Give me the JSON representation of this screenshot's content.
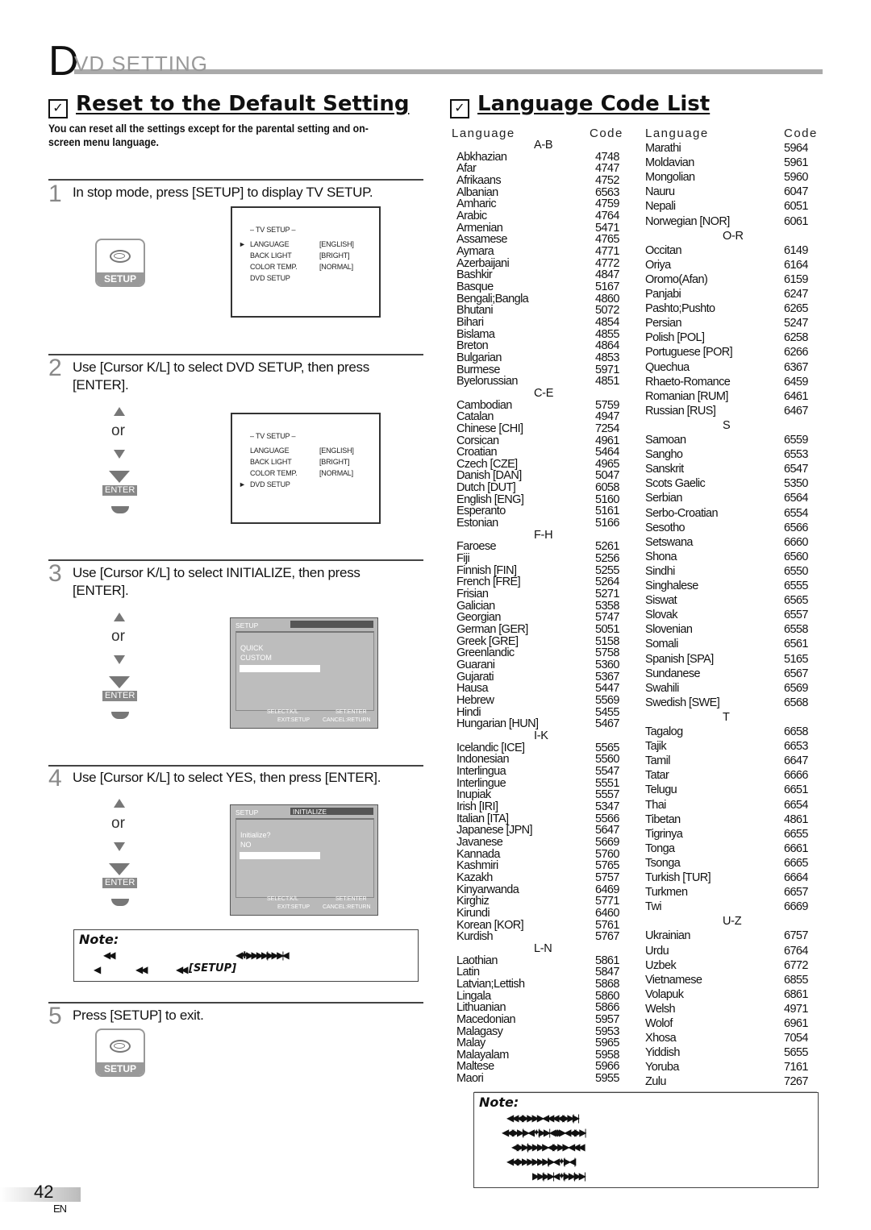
{
  "header": {
    "big_letter": "D",
    "rest": "VD  SETTING"
  },
  "reset_section": {
    "title": "Reset to the Default Setting",
    "intro": "You can reset all the settings except for the parental setting and on-screen menu language.",
    "steps": [
      {
        "num": "1",
        "text": "In stop mode, press [SETUP] to display  TV SETUP."
      },
      {
        "num": "2",
        "text": "Use [Cursor K/L] to select  DVD SETUP, then press [ENTER]."
      },
      {
        "num": "3",
        "text": "Use [Cursor K/L] to select  INITIALIZE, then press [ENTER]."
      },
      {
        "num": "4",
        "text": "Use [Cursor K/L] to select  YES, then press [ENTER]."
      },
      {
        "num": "5",
        "text": "Press [SETUP] to exit."
      }
    ],
    "setup_key_label": "SETUP",
    "enter_key_label": "ENTER",
    "or_label": "or",
    "tv_setup_screen": {
      "title": "– TV SETUP –",
      "items": [
        {
          "label": "LANGUAGE",
          "value": "[ENGLISH]"
        },
        {
          "label": "BACK LIGHT",
          "value": "[BRIGHT]"
        },
        {
          "label": "COLOR TEMP.",
          "value": "[NORMAL]"
        },
        {
          "label": "DVD SETUP",
          "value": ""
        }
      ],
      "cursor_marker": "►"
    },
    "osd_step3": {
      "title": "SETUP",
      "tab": "",
      "lines": [
        "QUICK",
        "CUSTOM"
      ],
      "footer": {
        "select": "SELECT:K/L",
        "set": "SET:ENTER",
        "exit": "EXIT:SETUP",
        "cancel": "CANCEL:RETURN"
      }
    },
    "osd_step4": {
      "title": "SETUP",
      "tab": "INITIALIZE",
      "lines": [
        "Initialize?",
        "NO"
      ],
      "footer": {
        "select": "SELECT:K/L",
        "set": "SET:ENTER",
        "exit": "EXIT:SETUP",
        "cancel": "CANCEL:RETURN"
      }
    },
    "note": {
      "title": "Note:",
      "line1a": "◀◀",
      "line1b": "◀✱▶▶▶▶|▶▶ ▶|◀",
      "line2a": "◀",
      "line2b": "◀◀",
      "line2c": "◀◀",
      "line2d": "[SETUP]"
    }
  },
  "language_section": {
    "title": "Language Code List",
    "col_language": "Language",
    "col_code": "Code",
    "left_column": [
      {
        "group": "A-B"
      },
      {
        "name": "Abkhazian",
        "code": "4748"
      },
      {
        "name": "Afar",
        "code": "4747"
      },
      {
        "name": "Afrikaans",
        "code": "4752"
      },
      {
        "name": "Albanian",
        "code": "6563"
      },
      {
        "name": "Amharic",
        "code": "4759"
      },
      {
        "name": "Arabic",
        "code": "4764"
      },
      {
        "name": "Armenian",
        "code": "5471"
      },
      {
        "name": "Assamese",
        "code": "4765"
      },
      {
        "name": "Aymara",
        "code": "4771"
      },
      {
        "name": "Azerbaijani",
        "code": "4772"
      },
      {
        "name": "Bashkir",
        "code": "4847"
      },
      {
        "name": "Basque",
        "code": "5167"
      },
      {
        "name": "Bengali;Bangla",
        "code": "4860"
      },
      {
        "name": "Bhutani",
        "code": "5072"
      },
      {
        "name": "Bihari",
        "code": "4854"
      },
      {
        "name": "Bislama",
        "code": "4855"
      },
      {
        "name": "Breton",
        "code": "4864"
      },
      {
        "name": "Bulgarian",
        "code": "4853"
      },
      {
        "name": "Burmese",
        "code": "5971"
      },
      {
        "name": "Byelorussian",
        "code": "4851"
      },
      {
        "group": "C-E"
      },
      {
        "name": "Cambodian",
        "code": "5759"
      },
      {
        "name": "Catalan",
        "code": "4947"
      },
      {
        "name": "Chinese [CHI]",
        "code": "7254"
      },
      {
        "name": "Corsican",
        "code": "4961"
      },
      {
        "name": "Croatian",
        "code": "5464"
      },
      {
        "name": "Czech [CZE]",
        "code": "4965"
      },
      {
        "name": "Danish [DAN]",
        "code": "5047"
      },
      {
        "name": "Dutch [DUT]",
        "code": "6058"
      },
      {
        "name": "English [ENG]",
        "code": "5160"
      },
      {
        "name": "Esperanto",
        "code": "5161"
      },
      {
        "name": "Estonian",
        "code": "5166"
      },
      {
        "group": "F-H"
      },
      {
        "name": "Faroese",
        "code": "5261"
      },
      {
        "name": "Fiji",
        "code": "5256"
      },
      {
        "name": "Finnish [FIN]",
        "code": "5255"
      },
      {
        "name": "French [FRE]",
        "code": "5264"
      },
      {
        "name": "Frisian",
        "code": "5271"
      },
      {
        "name": "Galician",
        "code": "5358"
      },
      {
        "name": "Georgian",
        "code": "5747"
      },
      {
        "name": "German [GER]",
        "code": "5051"
      },
      {
        "name": "Greek [GRE]",
        "code": "5158"
      },
      {
        "name": "Greenlandic",
        "code": "5758"
      },
      {
        "name": "Guarani",
        "code": "5360"
      },
      {
        "name": "Gujarati",
        "code": "5367"
      },
      {
        "name": "Hausa",
        "code": "5447"
      },
      {
        "name": "Hebrew",
        "code": "5569"
      },
      {
        "name": "Hindi",
        "code": "5455"
      },
      {
        "name": "Hungarian [HUN]",
        "code": "5467"
      },
      {
        "group": "I-K"
      },
      {
        "name": "Icelandic [ICE]",
        "code": "5565"
      },
      {
        "name": "Indonesian",
        "code": "5560"
      },
      {
        "name": "Interlingua",
        "code": "5547"
      },
      {
        "name": "Interlingue",
        "code": "5551"
      },
      {
        "name": "Inupiak",
        "code": "5557"
      },
      {
        "name": "Irish [IRI]",
        "code": "5347"
      },
      {
        "name": "Italian [ITA]",
        "code": "5566"
      },
      {
        "name": "Japanese [JPN]",
        "code": "5647"
      },
      {
        "name": "Javanese",
        "code": "5669"
      },
      {
        "name": "Kannada",
        "code": "5760"
      },
      {
        "name": "Kashmiri",
        "code": "5765"
      },
      {
        "name": "Kazakh",
        "code": "5757"
      },
      {
        "name": "Kinyarwanda",
        "code": "6469"
      },
      {
        "name": "Kirghiz",
        "code": "5771"
      },
      {
        "name": "Kirundi",
        "code": "6460"
      },
      {
        "name": "Korean [KOR]",
        "code": "5761"
      },
      {
        "name": "Kurdish",
        "code": "5767"
      },
      {
        "group": "L-N"
      },
      {
        "name": "Laothian",
        "code": "5861"
      },
      {
        "name": "Latin",
        "code": "5847"
      },
      {
        "name": "Latvian;Lettish",
        "code": "5868"
      },
      {
        "name": "Lingala",
        "code": "5860"
      },
      {
        "name": "Lithuanian",
        "code": "5866"
      },
      {
        "name": "Macedonian",
        "code": "5957"
      },
      {
        "name": "Malagasy",
        "code": "5953"
      },
      {
        "name": "Malay",
        "code": "5965"
      },
      {
        "name": "Malayalam",
        "code": "5958"
      },
      {
        "name": "Maltese",
        "code": "5966"
      },
      {
        "name": "Maori",
        "code": "5955"
      }
    ],
    "right_column": [
      {
        "name": "Marathi",
        "code": "5964"
      },
      {
        "name": "Moldavian",
        "code": "5961"
      },
      {
        "name": "Mongolian",
        "code": "5960"
      },
      {
        "name": "Nauru",
        "code": "6047"
      },
      {
        "name": "Nepali",
        "code": "6051"
      },
      {
        "name": "Norwegian [NOR]",
        "code": "6061"
      },
      {
        "group": "O-R"
      },
      {
        "name": "Occitan",
        "code": "6149"
      },
      {
        "name": "Oriya",
        "code": "6164"
      },
      {
        "name": "Oromo(Afan)",
        "code": "6159"
      },
      {
        "name": "Panjabi",
        "code": "6247"
      },
      {
        "name": "Pashto;Pushto",
        "code": "6265"
      },
      {
        "name": "Persian",
        "code": "5247"
      },
      {
        "name": "Polish [POL]",
        "code": "6258"
      },
      {
        "name": "Portuguese [POR]",
        "code": "6266"
      },
      {
        "name": "Quechua",
        "code": "6367"
      },
      {
        "name": "Rhaeto-Romance",
        "code": "6459"
      },
      {
        "name": "Romanian [RUM]",
        "code": "6461"
      },
      {
        "name": "Russian [RUS]",
        "code": "6467"
      },
      {
        "group": "S"
      },
      {
        "name": "Samoan",
        "code": "6559"
      },
      {
        "name": "Sangho",
        "code": "6553"
      },
      {
        "name": "Sanskrit",
        "code": "6547"
      },
      {
        "name": "Scots Gaelic",
        "code": "5350"
      },
      {
        "name": "Serbian",
        "code": "6564"
      },
      {
        "name": "Serbo-Croatian",
        "code": "6554"
      },
      {
        "name": "Sesotho",
        "code": "6566"
      },
      {
        "name": "Setswana",
        "code": "6660"
      },
      {
        "name": "Shona",
        "code": "6560"
      },
      {
        "name": "Sindhi",
        "code": "6550"
      },
      {
        "name": "Singhalese",
        "code": "6555"
      },
      {
        "name": "Siswat",
        "code": "6565"
      },
      {
        "name": "Slovak",
        "code": "6557"
      },
      {
        "name": "Slovenian",
        "code": "6558"
      },
      {
        "name": "Somali",
        "code": "6561"
      },
      {
        "name": "Spanish [SPA]",
        "code": "5165"
      },
      {
        "name": "Sundanese",
        "code": "6567"
      },
      {
        "name": "Swahili",
        "code": "6569"
      },
      {
        "name": "Swedish [SWE]",
        "code": "6568"
      },
      {
        "group": "T"
      },
      {
        "name": "Tagalog",
        "code": "6658"
      },
      {
        "name": "Tajik",
        "code": "6653"
      },
      {
        "name": "Tamil",
        "code": "6647"
      },
      {
        "name": "Tatar",
        "code": "6666"
      },
      {
        "name": "Telugu",
        "code": "6651"
      },
      {
        "name": "Thai",
        "code": "6654"
      },
      {
        "name": "Tibetan",
        "code": "4861"
      },
      {
        "name": "Tigrinya",
        "code": "6655"
      },
      {
        "name": "Tonga",
        "code": "6661"
      },
      {
        "name": "Tsonga",
        "code": "6665"
      },
      {
        "name": "Turkish [TUR]",
        "code": "6664"
      },
      {
        "name": "Turkmen",
        "code": "6657"
      },
      {
        "name": "Twi",
        "code": "6669"
      },
      {
        "group": "U-Z"
      },
      {
        "name": "Ukrainian",
        "code": "6757"
      },
      {
        "name": "Urdu",
        "code": "6764"
      },
      {
        "name": "Uzbek",
        "code": "6772"
      },
      {
        "name": "Vietnamese",
        "code": "6855"
      },
      {
        "name": "Volapuk",
        "code": "6861"
      },
      {
        "name": "Welsh",
        "code": "4971"
      },
      {
        "name": "Wolof",
        "code": "6961"
      },
      {
        "name": "Xhosa",
        "code": "7054"
      },
      {
        "name": "Yiddish",
        "code": "5655"
      },
      {
        "name": "Yoruba",
        "code": "7161"
      },
      {
        "name": "Zulu",
        "code": "7267"
      }
    ],
    "note": {
      "title": "Note:",
      "lines": [
        "◀◀◀        ▶▶▶▶◀◀◀◀                              ▶▶|▶|",
        "◀◀  ▶▶|  ▶◀✦|              ▶▶|        ◀◆▶◀◀   ▶▶|",
        "◀  ▶▶|  ▶▶▶▶◀  ▶▶▶                      ◀◀◀",
        "◀◀   ▶▶▶▶       ▶▶|  ▶◀✦|      ▶◀|",
        "▶▶|▶▶|◀✦|▶▶| ▶▶|"
      ]
    }
  },
  "footer": {
    "page_number": "42",
    "lang": "EN"
  }
}
